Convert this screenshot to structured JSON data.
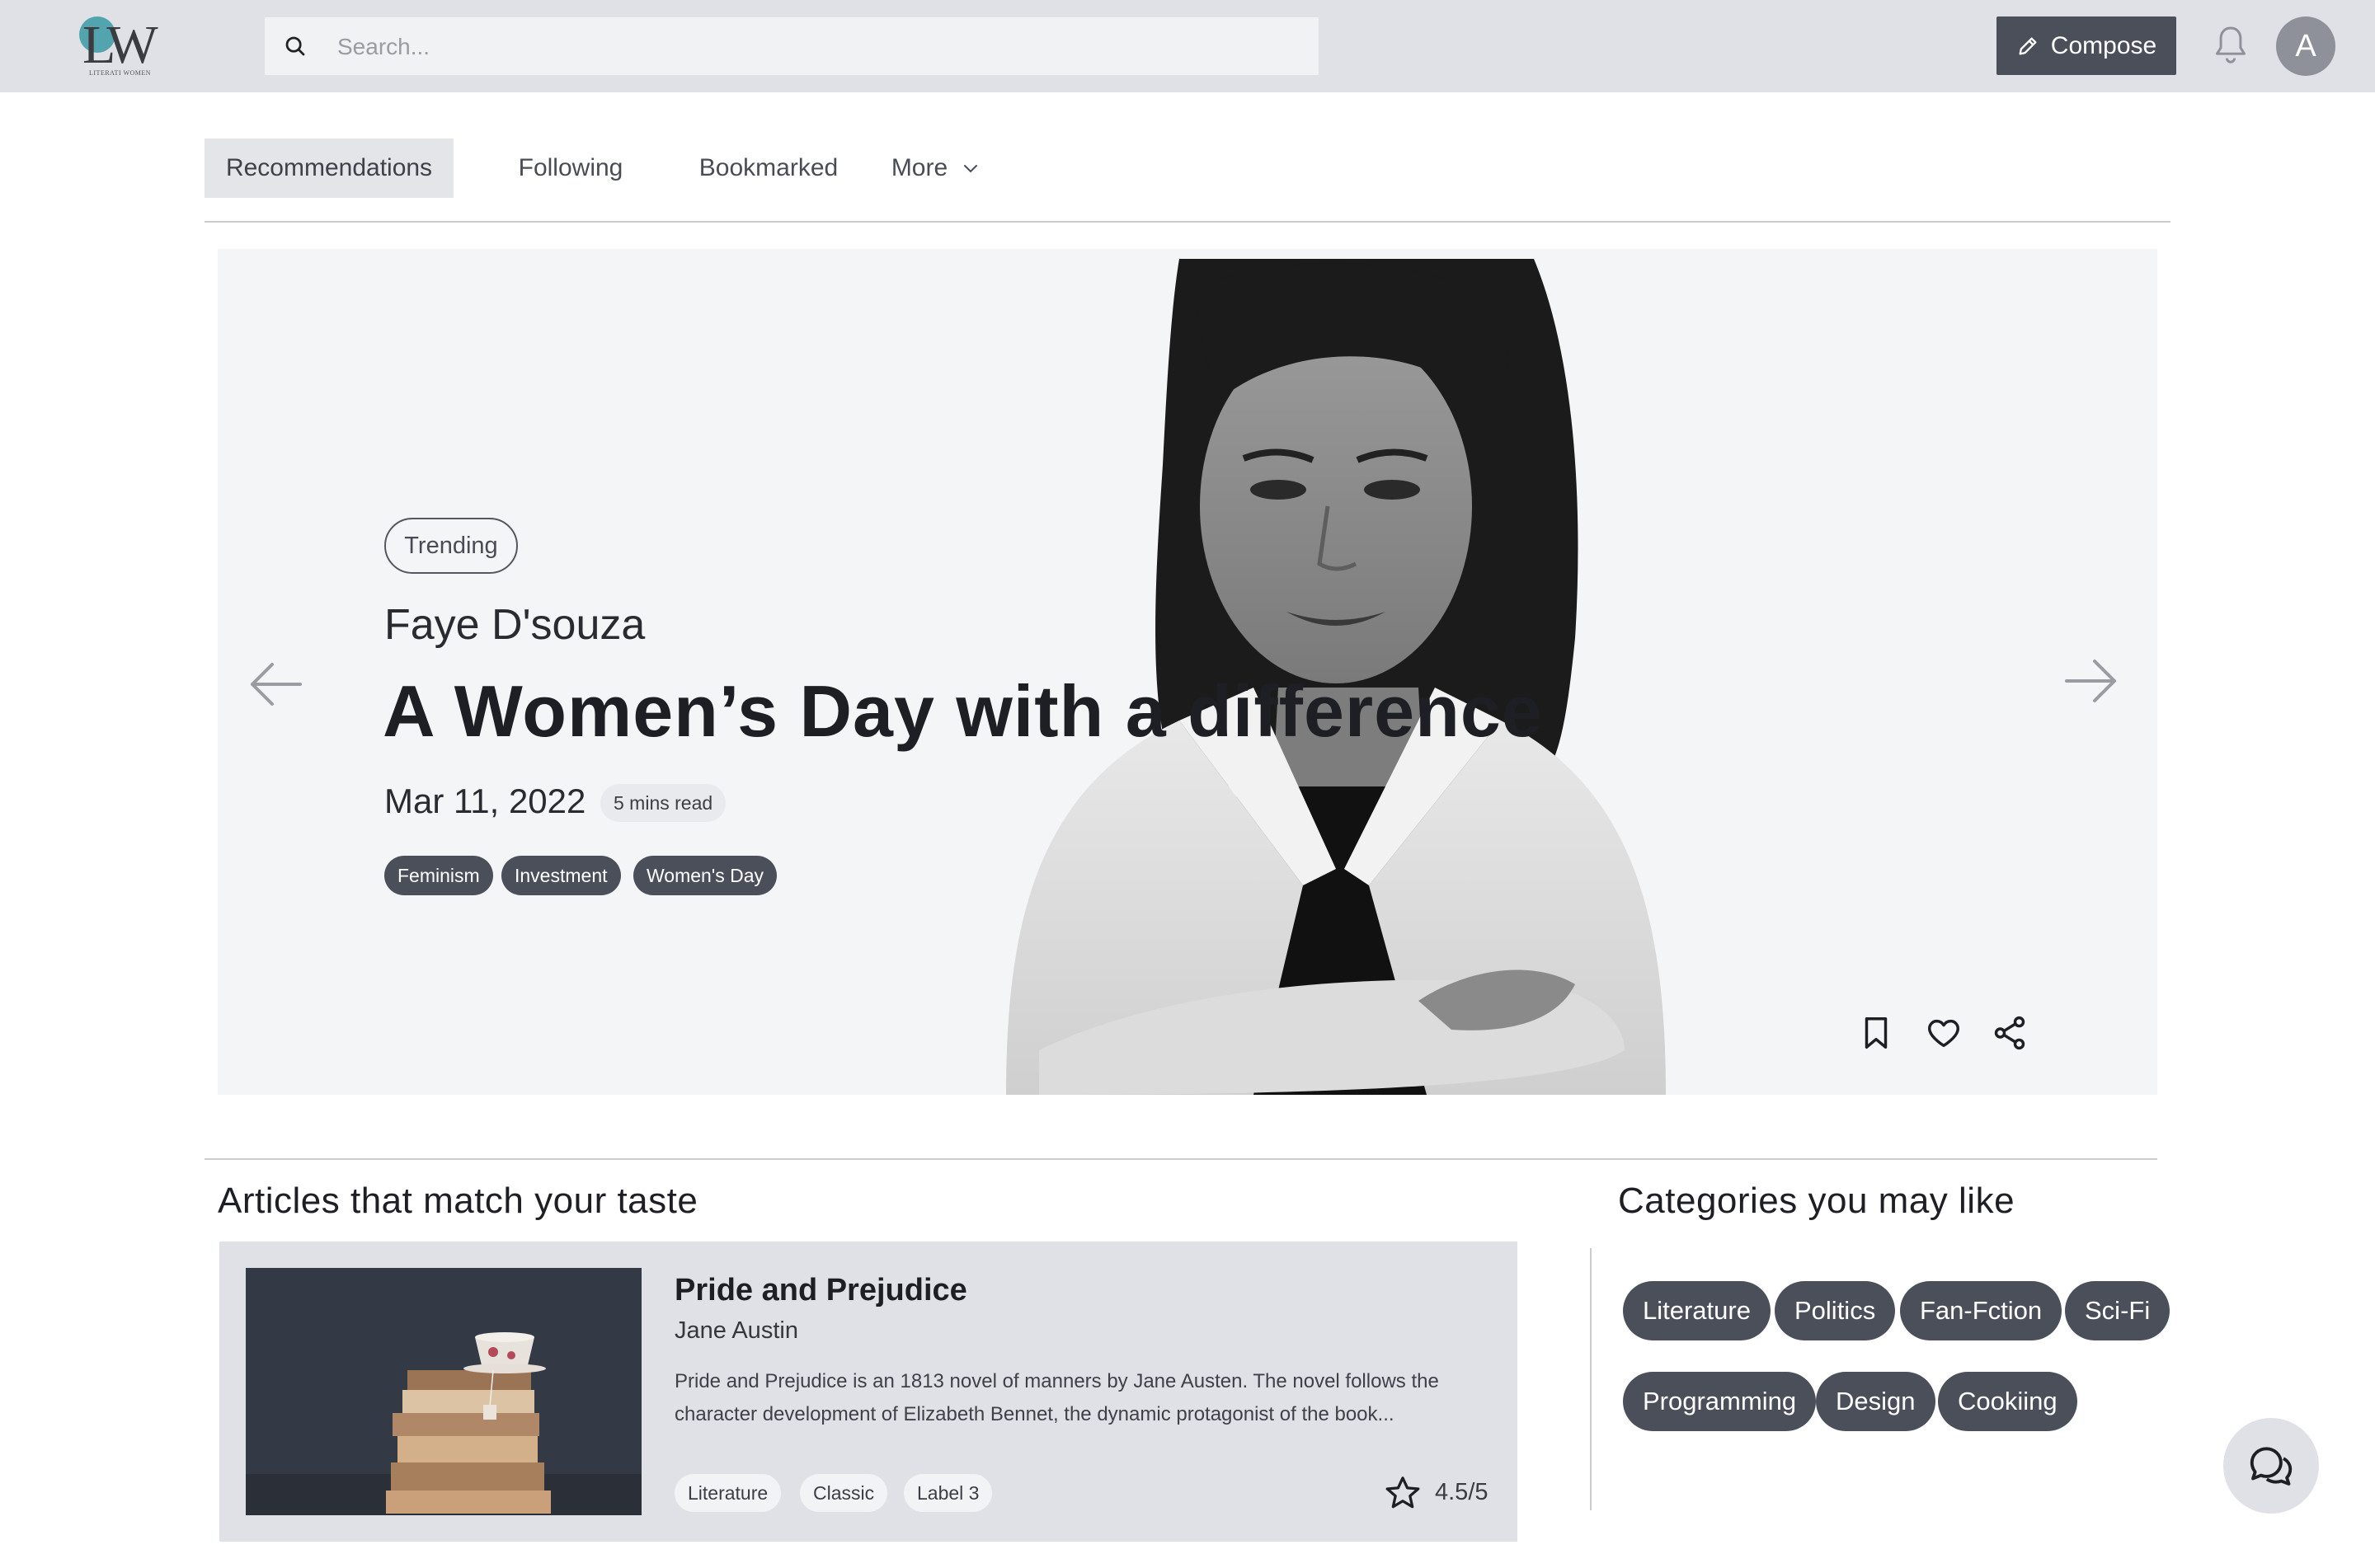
{
  "header": {
    "logo_text": "LW",
    "logo_subtitle": "LITERATI WOMEN",
    "search_placeholder": "Search...",
    "compose_label": "Compose",
    "avatar_initial": "A"
  },
  "tabs": [
    {
      "label": "Recommendations",
      "active": true
    },
    {
      "label": "Following",
      "active": false
    },
    {
      "label": "Bookmarked",
      "active": false
    },
    {
      "label": "More",
      "active": false
    }
  ],
  "hero": {
    "badge": "Trending",
    "author": "Faye D'souza",
    "title": "A Women’s Day with a difference",
    "date": "Mar 11, 2022",
    "read_time": "5 mins read",
    "tags": [
      "Feminism",
      "Investment",
      "Women's Day"
    ]
  },
  "articles": {
    "section_title": "Articles that match your taste",
    "items": [
      {
        "title": "Pride and Prejudice",
        "author": "Jane Austin",
        "description": "Pride and Prejudice is an 1813 novel of manners by Jane Austen. The novel follows the character development of Elizabeth Bennet, the dynamic protagonist of the book...",
        "labels": [
          "Literature",
          "Classic",
          "Label 3"
        ],
        "rating": "4.5/5"
      }
    ]
  },
  "categories": {
    "section_title": "Categories you may like",
    "items": [
      "Literature",
      "Politics",
      "Fan-Fction",
      "Sci-Fi",
      "Programming",
      "Design",
      "Cookiing"
    ]
  },
  "colors": {
    "header_bg": "#dfe1e6",
    "dark_chip": "#4b4f5a",
    "accent_logo": "#3a9aa3"
  }
}
